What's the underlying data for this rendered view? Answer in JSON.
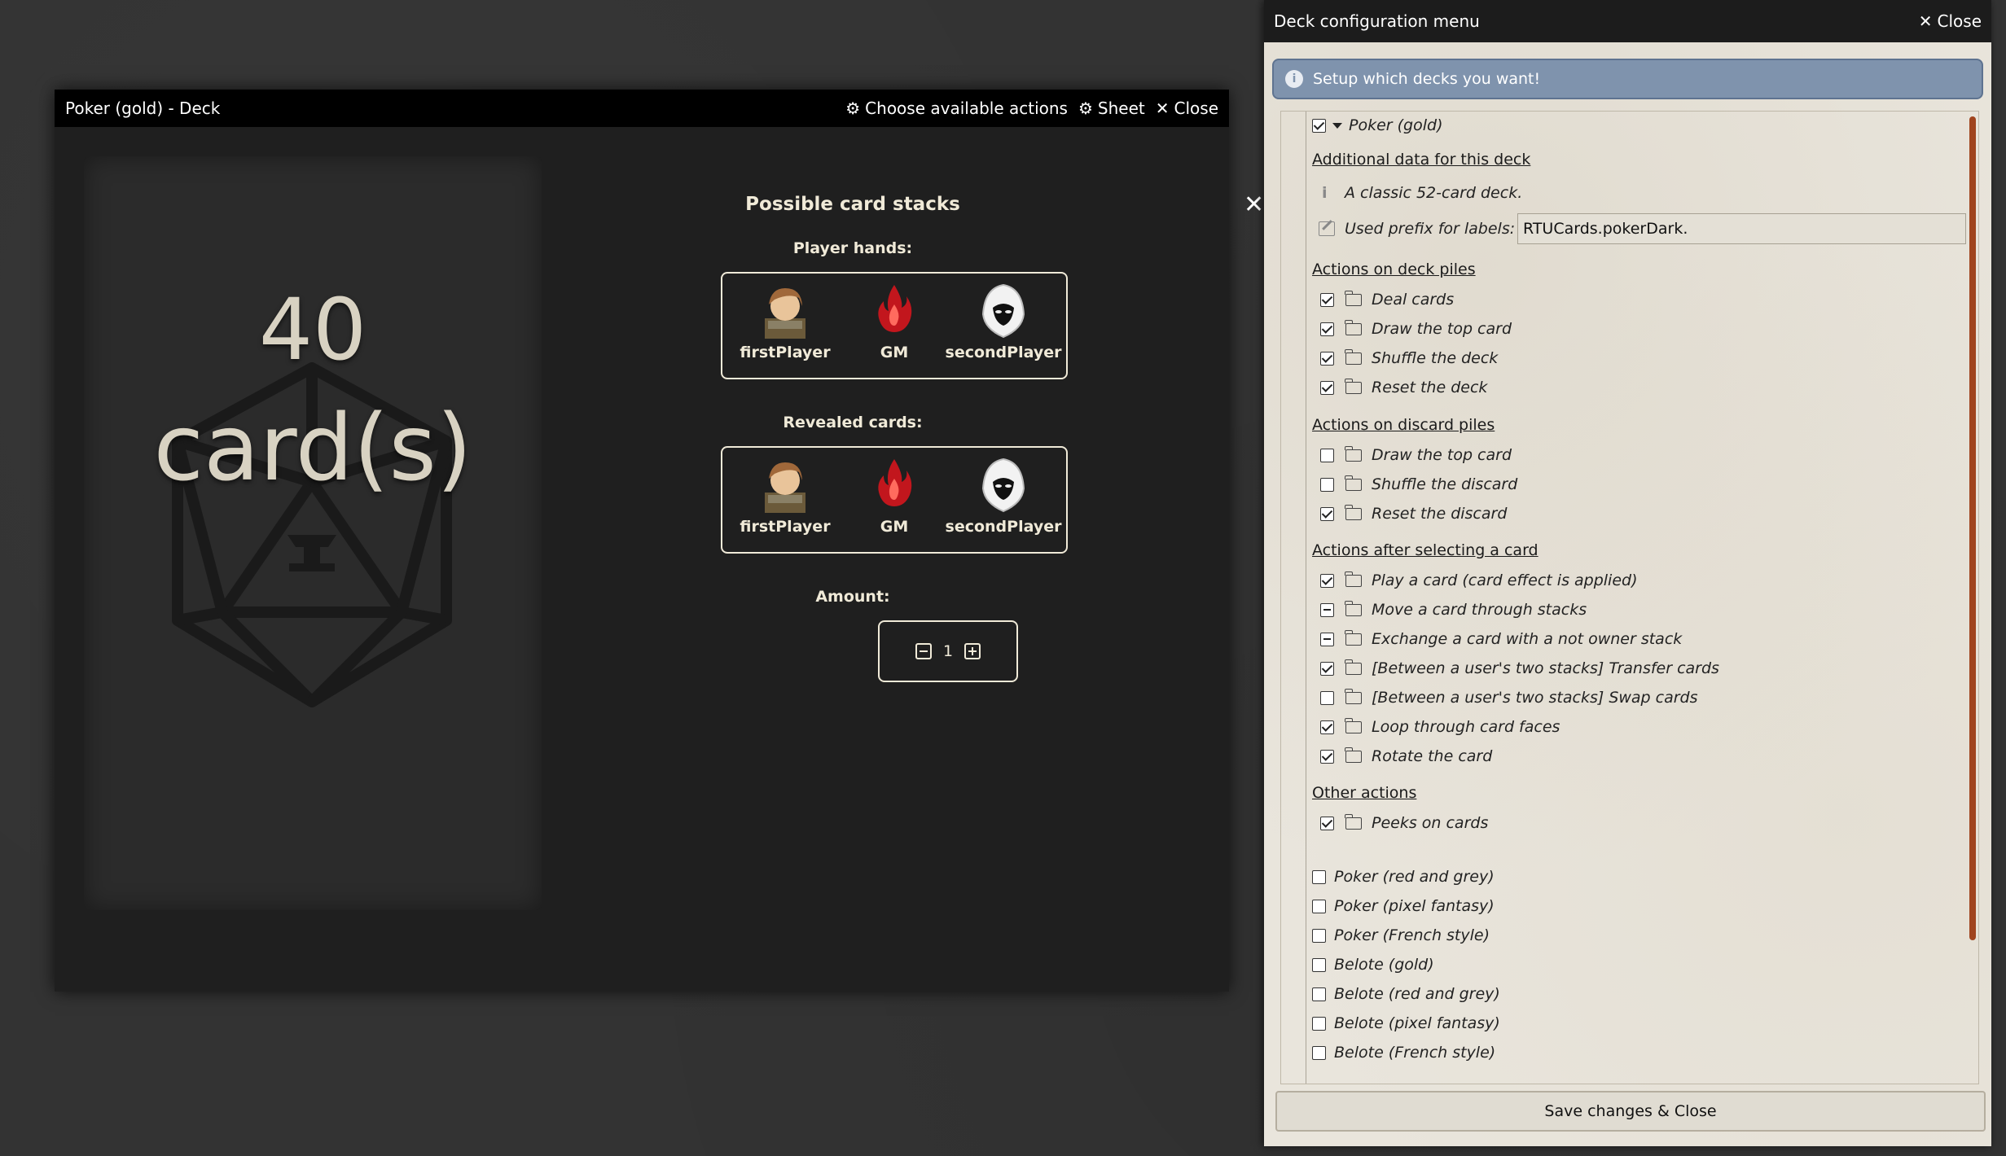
{
  "deck_window": {
    "title": "Poker (gold) - Deck",
    "actions": [
      {
        "icon": "gear-icon",
        "label": "Choose available actions"
      },
      {
        "icon": "gear-icon",
        "label": "Sheet"
      },
      {
        "icon": "close-icon",
        "label": "Close"
      }
    ],
    "card_count": "40",
    "card_unit": "card(s)"
  },
  "stacks_panel": {
    "title": "Possible card stacks",
    "player_hands_label": "Player hands:",
    "revealed_cards_label": "Revealed cards:",
    "owners": [
      {
        "name": "firstPlayer"
      },
      {
        "name": "GM"
      },
      {
        "name": "secondPlayer"
      }
    ],
    "amount_label": "Amount:",
    "amount_value": "1"
  },
  "config_panel": {
    "title": "Deck configuration menu",
    "close_label": "Close",
    "info_message": "Setup which decks you want!",
    "selected_deck": {
      "name": "Poker (gold)",
      "checked": true
    },
    "additional_data_title": "Additional data for this deck",
    "description": "A classic 52-card deck.",
    "prefix_label": "Used prefix for labels:",
    "prefix_value": "RTUCards.pokerDark.",
    "sections": [
      {
        "title": "Actions on deck piles",
        "items": [
          {
            "label": "Deal cards",
            "state": "checked"
          },
          {
            "label": "Draw the top card",
            "state": "checked"
          },
          {
            "label": "Shuffle the deck",
            "state": "checked"
          },
          {
            "label": "Reset the deck",
            "state": "checked"
          }
        ]
      },
      {
        "title": "Actions on discard piles",
        "items": [
          {
            "label": "Draw the top card",
            "state": "unchecked"
          },
          {
            "label": "Shuffle the discard",
            "state": "unchecked"
          },
          {
            "label": "Reset the discard",
            "state": "checked"
          }
        ]
      },
      {
        "title": "Actions after selecting a card",
        "items": [
          {
            "label": "Play a card (card effect is applied)",
            "state": "checked"
          },
          {
            "label": "Move a card through stacks",
            "state": "mixed"
          },
          {
            "label": "Exchange a card with a not owner stack",
            "state": "mixed"
          },
          {
            "label": "[Between a user's two stacks] Transfer cards",
            "state": "checked"
          },
          {
            "label": "[Between a user's two stacks] Swap cards",
            "state": "unchecked"
          },
          {
            "label": "Loop through card faces",
            "state": "checked"
          },
          {
            "label": "Rotate the card",
            "state": "checked"
          }
        ]
      },
      {
        "title": "Other actions",
        "items": [
          {
            "label": "Peeks on cards",
            "state": "checked"
          }
        ]
      }
    ],
    "other_decks": [
      "Poker (red and grey)",
      "Poker (pixel fantasy)",
      "Poker (French style)",
      "Belote (gold)",
      "Belote (red and grey)",
      "Belote (pixel fantasy)",
      "Belote (French style)"
    ],
    "save_label": "Save changes & Close"
  }
}
